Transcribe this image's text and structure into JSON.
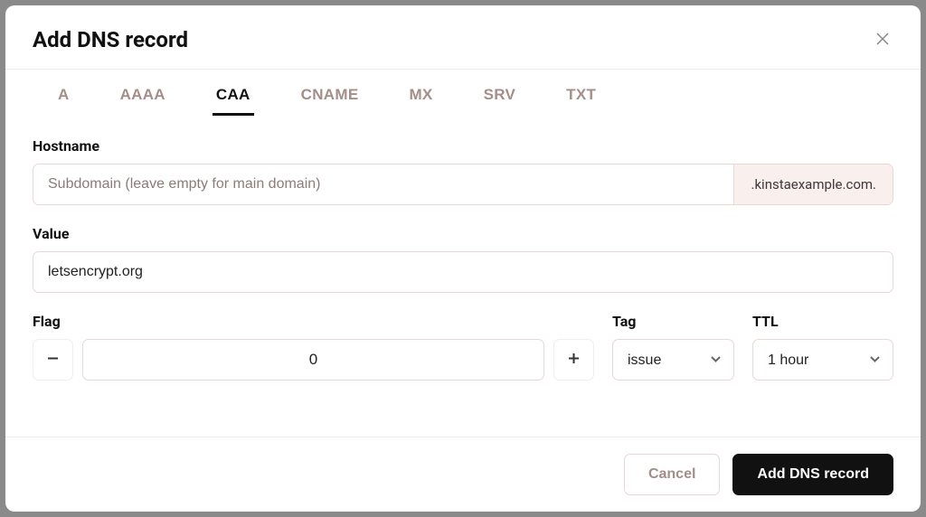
{
  "modal": {
    "title": "Add DNS record"
  },
  "tabs": [
    {
      "label": "A",
      "active": false
    },
    {
      "label": "AAAA",
      "active": false
    },
    {
      "label": "CAA",
      "active": true
    },
    {
      "label": "CNAME",
      "active": false
    },
    {
      "label": "MX",
      "active": false
    },
    {
      "label": "SRV",
      "active": false
    },
    {
      "label": "TXT",
      "active": false
    }
  ],
  "fields": {
    "hostname": {
      "label": "Hostname",
      "placeholder": "Subdomain (leave empty for main domain)",
      "value": "",
      "suffix": ".kinstaexample.com."
    },
    "value": {
      "label": "Value",
      "value": "letsencrypt.org"
    },
    "flag": {
      "label": "Flag",
      "value": "0"
    },
    "tag": {
      "label": "Tag",
      "value": "issue"
    },
    "ttl": {
      "label": "TTL",
      "value": "1 hour"
    }
  },
  "buttons": {
    "cancel": "Cancel",
    "submit": "Add DNS record"
  }
}
